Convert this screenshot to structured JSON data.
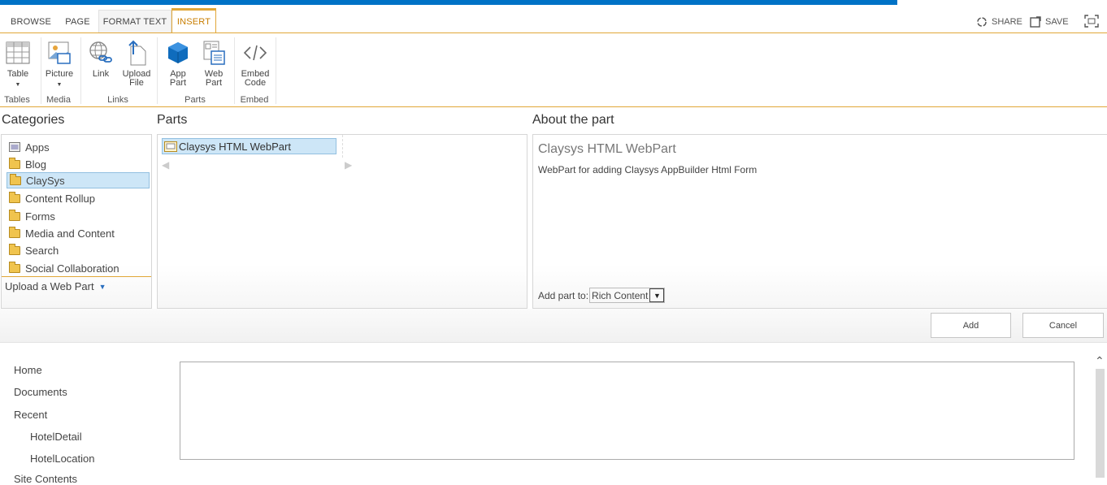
{
  "tabs": [
    {
      "label": "BROWSE"
    },
    {
      "label": "PAGE"
    },
    {
      "label": "FORMAT TEXT"
    },
    {
      "label": "INSERT"
    }
  ],
  "top_actions": {
    "share": "SHARE",
    "save": "SAVE"
  },
  "ribbon": {
    "table": "Table",
    "picture": "Picture",
    "link": "Link",
    "upload_file_1": "Upload",
    "upload_file_2": "File",
    "app_part_1": "App",
    "app_part_2": "Part",
    "web_part_1": "Web",
    "web_part_2": "Part",
    "embed_code_1": "Embed",
    "embed_code_2": "Code",
    "groups": {
      "tables": "Tables",
      "media": "Media",
      "links": "Links",
      "parts": "Parts",
      "embed": "Embed"
    }
  },
  "categories": {
    "header": "Categories",
    "items": [
      "Apps",
      "Blog",
      "ClaySys",
      "Content Rollup",
      "Forms",
      "Media and Content",
      "Search",
      "Social Collaboration"
    ],
    "upload": "Upload a Web Part"
  },
  "parts": {
    "header": "Parts",
    "items": [
      "Claysys HTML WebPart"
    ]
  },
  "about": {
    "header": "About the part",
    "title": "Claysys HTML WebPart",
    "description": "WebPart for adding Claysys AppBuilder Html Form",
    "add_to_label": "Add part to:",
    "add_to_value": "Rich Content"
  },
  "buttons": {
    "add": "Add",
    "cancel": "Cancel"
  },
  "left_nav": {
    "items": [
      "Home",
      "Documents",
      "Recent"
    ],
    "sub_items": [
      "HotelDetail",
      "HotelLocation"
    ],
    "partial": "Site Contents"
  }
}
